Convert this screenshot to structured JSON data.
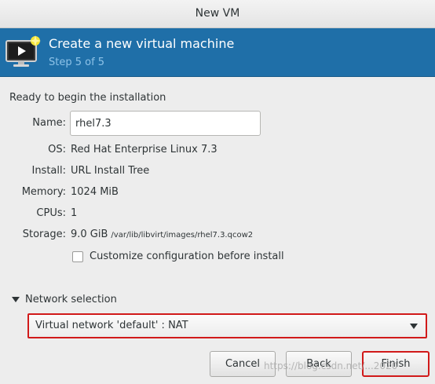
{
  "window": {
    "title": "New VM"
  },
  "banner": {
    "title": "Create a new virtual machine",
    "step": "Step 5 of 5",
    "icon": "monitor-play-icon",
    "bg_color": "#1f6fa8"
  },
  "summary": {
    "heading": "Ready to begin the installation",
    "name_label": "Name:",
    "name_value": "rhel7.3",
    "os_label": "OS:",
    "os_value": "Red Hat Enterprise Linux 7.3",
    "install_label": "Install:",
    "install_value": "URL Install Tree",
    "memory_label": "Memory:",
    "memory_value": "1024 MiB",
    "cpus_label": "CPUs:",
    "cpus_value": "1",
    "storage_label": "Storage:",
    "storage_value": "9.0 GiB",
    "storage_path": "/var/lib/libvirt/images/rhel7.3.qcow2",
    "customize_label": "Customize configuration before install",
    "customize_checked": false
  },
  "network": {
    "expander_label": "Network selection",
    "selected": "Virtual network 'default' : NAT"
  },
  "buttons": {
    "cancel": "Cancel",
    "back": "Back",
    "finish": "Finish"
  },
  "watermark": "https://blog.csdn.net/...2020",
  "colors": {
    "highlight": "#d11a1a"
  }
}
